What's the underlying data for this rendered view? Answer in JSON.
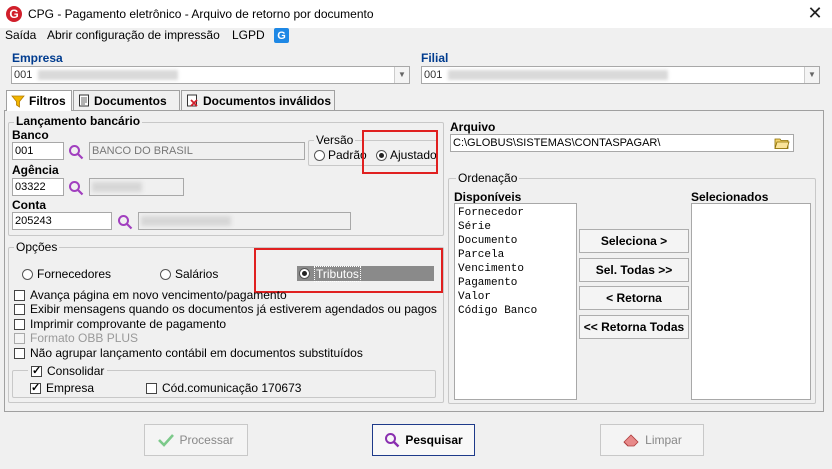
{
  "window": {
    "title": "CPG - Pagamento eletrônico - Arquivo de retorno por documento",
    "app_icon": "G",
    "close": "✕"
  },
  "menu": {
    "items": [
      "Saída",
      "Abrir configuração de impressão",
      "LGPD"
    ],
    "globus_icon": "G"
  },
  "empresa": {
    "label": "Empresa",
    "value": "001"
  },
  "filial": {
    "label": "Filial",
    "value": "001"
  },
  "tabs": [
    {
      "label": "Filtros",
      "icon": "funnel-icon"
    },
    {
      "label": "Documentos",
      "icon": "document-icon"
    },
    {
      "label": "Documentos inválidos",
      "icon": "document-x-icon"
    }
  ],
  "lancamento": {
    "title": "Lançamento bancário",
    "banco_label": "Banco",
    "banco_code": "001",
    "banco_name": "BANCO DO BRASIL",
    "versao_title": "Versão",
    "versao_padrao": "Padrão",
    "versao_ajustado": "Ajustado",
    "agencia_label": "Agência",
    "agencia_code": "03322",
    "conta_label": "Conta",
    "conta_code": "205243"
  },
  "opcoes": {
    "title": "Opções",
    "radio_fornecedores": "Fornecedores",
    "radio_salarios": "Salários",
    "radio_tributos": "Tributos",
    "checks": [
      "Avança página em novo vencimento/pagamento",
      "Exibir mensagens quando os documentos já estiverem agendados ou pagos",
      "Imprimir comprovante de pagamento",
      "Formato OBB PLUS",
      "Não agrupar lançamento contábil em documentos substituídos"
    ],
    "consolidar_label": "Consolidar",
    "empresa_label": "Empresa",
    "cod_comunicacao_label": "Cód.comunicação 170673"
  },
  "arquivo": {
    "label": "Arquivo",
    "path": "C:\\GLOBUS\\SISTEMAS\\CONTASPAGAR\\"
  },
  "ordenacao": {
    "title": "Ordenação",
    "disponiveis_label": "Disponíveis",
    "selecionados_label": "Selecionados",
    "disponiveis": [
      "Fornecedor",
      "Série",
      "Documento",
      "Parcela",
      "Vencimento",
      "Pagamento",
      "Valor",
      "Código Banco"
    ],
    "btn_seleciona": "Seleciona >",
    "btn_sel_todas": "Sel. Todas >>",
    "btn_retorna": "< Retorna",
    "btn_retorna_todas": "<< Retorna Todas"
  },
  "footer": {
    "processar": "Processar",
    "pesquisar": "Pesquisar",
    "limpar": "Limpar"
  }
}
